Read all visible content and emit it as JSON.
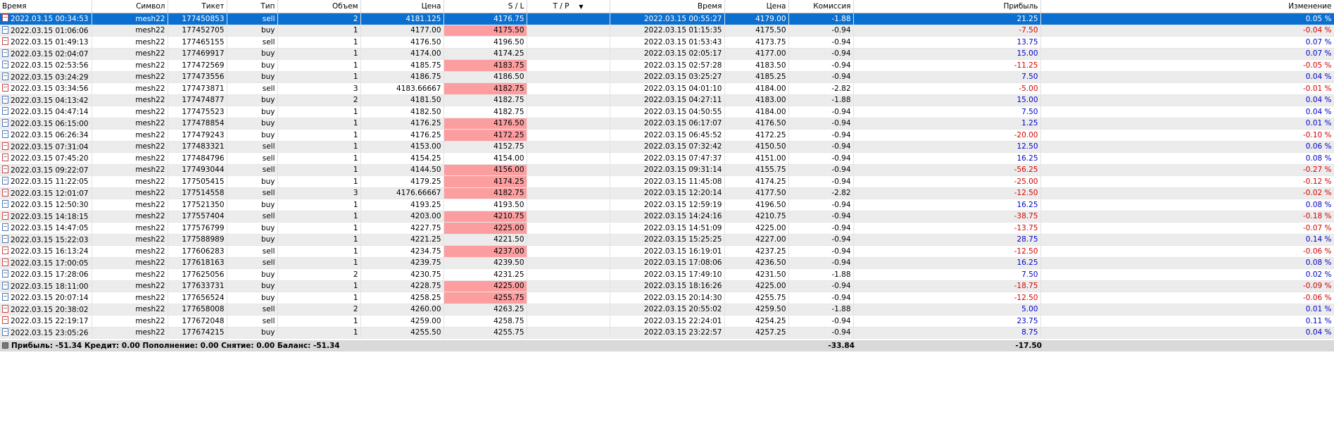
{
  "columns": [
    "Время",
    "Символ",
    "Тикет",
    "Тип",
    "Объем",
    "Цена",
    "S / L",
    "T / P",
    "Время",
    "Цена",
    "Комиссия",
    "Прибыль",
    "Изменение"
  ],
  "rows": [
    {
      "time": "2022.03.15 00:34:53",
      "symbol": "mesh22",
      "ticket": "177450853",
      "type": "sell",
      "volume": "2",
      "price": "4181.125",
      "sl": "4176.75",
      "tp": "",
      "close_time": "2022.03.15 00:55:27",
      "close_price": "4179.00",
      "commission": "-1.88",
      "profit": "21.25",
      "change": "0.05 %",
      "sl_hit": false,
      "selected": true
    },
    {
      "time": "2022.03.15 01:06:06",
      "symbol": "mesh22",
      "ticket": "177452705",
      "type": "buy",
      "volume": "1",
      "price": "4177.00",
      "sl": "4175.50",
      "tp": "",
      "close_time": "2022.03.15 01:15:35",
      "close_price": "4175.50",
      "commission": "-0.94",
      "profit": "-7.50",
      "change": "-0.04 %",
      "sl_hit": true
    },
    {
      "time": "2022.03.15 01:49:13",
      "symbol": "mesh22",
      "ticket": "177465155",
      "type": "sell",
      "volume": "1",
      "price": "4176.50",
      "sl": "4196.50",
      "tp": "",
      "close_time": "2022.03.15 01:53:43",
      "close_price": "4173.75",
      "commission": "-0.94",
      "profit": "13.75",
      "change": "0.07 %",
      "sl_hit": false
    },
    {
      "time": "2022.03.15 02:04:07",
      "symbol": "mesh22",
      "ticket": "177469917",
      "type": "buy",
      "volume": "1",
      "price": "4174.00",
      "sl": "4174.25",
      "tp": "",
      "close_time": "2022.03.15 02:05:17",
      "close_price": "4177.00",
      "commission": "-0.94",
      "profit": "15.00",
      "change": "0.07 %",
      "sl_hit": false
    },
    {
      "time": "2022.03.15 02:53:56",
      "symbol": "mesh22",
      "ticket": "177472569",
      "type": "buy",
      "volume": "1",
      "price": "4185.75",
      "sl": "4183.75",
      "tp": "",
      "close_time": "2022.03.15 02:57:28",
      "close_price": "4183.50",
      "commission": "-0.94",
      "profit": "-11.25",
      "change": "-0.05 %",
      "sl_hit": true
    },
    {
      "time": "2022.03.15 03:24:29",
      "symbol": "mesh22",
      "ticket": "177473556",
      "type": "buy",
      "volume": "1",
      "price": "4186.75",
      "sl": "4186.50",
      "tp": "",
      "close_time": "2022.03.15 03:25:27",
      "close_price": "4185.25",
      "commission": "-0.94",
      "profit": "7.50",
      "change": "0.04 %",
      "sl_hit": false
    },
    {
      "time": "2022.03.15 03:34:56",
      "symbol": "mesh22",
      "ticket": "177473871",
      "type": "sell",
      "volume": "3",
      "price": "4183.66667",
      "sl": "4182.75",
      "tp": "",
      "close_time": "2022.03.15 04:01:10",
      "close_price": "4184.00",
      "commission": "-2.82",
      "profit": "-5.00",
      "change": "-0.01 %",
      "sl_hit": true
    },
    {
      "time": "2022.03.15 04:13:42",
      "symbol": "mesh22",
      "ticket": "177474877",
      "type": "buy",
      "volume": "2",
      "price": "4181.50",
      "sl": "4182.75",
      "tp": "",
      "close_time": "2022.03.15 04:27:11",
      "close_price": "4183.00",
      "commission": "-1.88",
      "profit": "15.00",
      "change": "0.04 %",
      "sl_hit": false
    },
    {
      "time": "2022.03.15 04:47:14",
      "symbol": "mesh22",
      "ticket": "177475523",
      "type": "buy",
      "volume": "1",
      "price": "4182.50",
      "sl": "4182.75",
      "tp": "",
      "close_time": "2022.03.15 04:50:55",
      "close_price": "4184.00",
      "commission": "-0.94",
      "profit": "7.50",
      "change": "0.04 %",
      "sl_hit": false
    },
    {
      "time": "2022.03.15 06:15:00",
      "symbol": "mesh22",
      "ticket": "177478854",
      "type": "buy",
      "volume": "1",
      "price": "4176.25",
      "sl": "4176.50",
      "tp": "",
      "close_time": "2022.03.15 06:17:07",
      "close_price": "4176.50",
      "commission": "-0.94",
      "profit": "1.25",
      "change": "0.01 %",
      "sl_hit": true
    },
    {
      "time": "2022.03.15 06:26:34",
      "symbol": "mesh22",
      "ticket": "177479243",
      "type": "buy",
      "volume": "1",
      "price": "4176.25",
      "sl": "4172.25",
      "tp": "",
      "close_time": "2022.03.15 06:45:52",
      "close_price": "4172.25",
      "commission": "-0.94",
      "profit": "-20.00",
      "change": "-0.10 %",
      "sl_hit": true
    },
    {
      "time": "2022.03.15 07:31:04",
      "symbol": "mesh22",
      "ticket": "177483321",
      "type": "sell",
      "volume": "1",
      "price": "4153.00",
      "sl": "4152.75",
      "tp": "",
      "close_time": "2022.03.15 07:32:42",
      "close_price": "4150.50",
      "commission": "-0.94",
      "profit": "12.50",
      "change": "0.06 %",
      "sl_hit": false
    },
    {
      "time": "2022.03.15 07:45:20",
      "symbol": "mesh22",
      "ticket": "177484796",
      "type": "sell",
      "volume": "1",
      "price": "4154.25",
      "sl": "4154.00",
      "tp": "",
      "close_time": "2022.03.15 07:47:37",
      "close_price": "4151.00",
      "commission": "-0.94",
      "profit": "16.25",
      "change": "0.08 %",
      "sl_hit": false
    },
    {
      "time": "2022.03.15 09:22:07",
      "symbol": "mesh22",
      "ticket": "177493044",
      "type": "sell",
      "volume": "1",
      "price": "4144.50",
      "sl": "4156.00",
      "tp": "",
      "close_time": "2022.03.15 09:31:14",
      "close_price": "4155.75",
      "commission": "-0.94",
      "profit": "-56.25",
      "change": "-0.27 %",
      "sl_hit": true
    },
    {
      "time": "2022.03.15 11:22:05",
      "symbol": "mesh22",
      "ticket": "177505415",
      "type": "buy",
      "volume": "1",
      "price": "4179.25",
      "sl": "4174.25",
      "tp": "",
      "close_time": "2022.03.15 11:45:08",
      "close_price": "4174.25",
      "commission": "-0.94",
      "profit": "-25.00",
      "change": "-0.12 %",
      "sl_hit": true
    },
    {
      "time": "2022.03.15 12:01:07",
      "symbol": "mesh22",
      "ticket": "177514558",
      "type": "sell",
      "volume": "3",
      "price": "4176.66667",
      "sl": "4182.75",
      "tp": "",
      "close_time": "2022.03.15 12:20:14",
      "close_price": "4177.50",
      "commission": "-2.82",
      "profit": "-12.50",
      "change": "-0.02 %",
      "sl_hit": true
    },
    {
      "time": "2022.03.15 12:50:30",
      "symbol": "mesh22",
      "ticket": "177521350",
      "type": "buy",
      "volume": "1",
      "price": "4193.25",
      "sl": "4193.50",
      "tp": "",
      "close_time": "2022.03.15 12:59:19",
      "close_price": "4196.50",
      "commission": "-0.94",
      "profit": "16.25",
      "change": "0.08 %",
      "sl_hit": false
    },
    {
      "time": "2022.03.15 14:18:15",
      "symbol": "mesh22",
      "ticket": "177557404",
      "type": "sell",
      "volume": "1",
      "price": "4203.00",
      "sl": "4210.75",
      "tp": "",
      "close_time": "2022.03.15 14:24:16",
      "close_price": "4210.75",
      "commission": "-0.94",
      "profit": "-38.75",
      "change": "-0.18 %",
      "sl_hit": true
    },
    {
      "time": "2022.03.15 14:47:05",
      "symbol": "mesh22",
      "ticket": "177576799",
      "type": "buy",
      "volume": "1",
      "price": "4227.75",
      "sl": "4225.00",
      "tp": "",
      "close_time": "2022.03.15 14:51:09",
      "close_price": "4225.00",
      "commission": "-0.94",
      "profit": "-13.75",
      "change": "-0.07 %",
      "sl_hit": true
    },
    {
      "time": "2022.03.15 15:22:03",
      "symbol": "mesh22",
      "ticket": "177588989",
      "type": "buy",
      "volume": "1",
      "price": "4221.25",
      "sl": "4221.50",
      "tp": "",
      "close_time": "2022.03.15 15:25:25",
      "close_price": "4227.00",
      "commission": "-0.94",
      "profit": "28.75",
      "change": "0.14 %",
      "sl_hit": false
    },
    {
      "time": "2022.03.15 16:13:24",
      "symbol": "mesh22",
      "ticket": "177606283",
      "type": "sell",
      "volume": "1",
      "price": "4234.75",
      "sl": "4237.00",
      "tp": "",
      "close_time": "2022.03.15 16:19:01",
      "close_price": "4237.25",
      "commission": "-0.94",
      "profit": "-12.50",
      "change": "-0.06 %",
      "sl_hit": true
    },
    {
      "time": "2022.03.15 17:00:05",
      "symbol": "mesh22",
      "ticket": "177618163",
      "type": "sell",
      "volume": "1",
      "price": "4239.75",
      "sl": "4239.50",
      "tp": "",
      "close_time": "2022.03.15 17:08:06",
      "close_price": "4236.50",
      "commission": "-0.94",
      "profit": "16.25",
      "change": "0.08 %",
      "sl_hit": false
    },
    {
      "time": "2022.03.15 17:28:06",
      "symbol": "mesh22",
      "ticket": "177625056",
      "type": "buy",
      "volume": "2",
      "price": "4230.75",
      "sl": "4231.25",
      "tp": "",
      "close_time": "2022.03.15 17:49:10",
      "close_price": "4231.50",
      "commission": "-1.88",
      "profit": "7.50",
      "change": "0.02 %",
      "sl_hit": false
    },
    {
      "time": "2022.03.15 18:11:00",
      "symbol": "mesh22",
      "ticket": "177633731",
      "type": "buy",
      "volume": "1",
      "price": "4228.75",
      "sl": "4225.00",
      "tp": "",
      "close_time": "2022.03.15 18:16:26",
      "close_price": "4225.00",
      "commission": "-0.94",
      "profit": "-18.75",
      "change": "-0.09 %",
      "sl_hit": true
    },
    {
      "time": "2022.03.15 20:07:14",
      "symbol": "mesh22",
      "ticket": "177656524",
      "type": "buy",
      "volume": "1",
      "price": "4258.25",
      "sl": "4255.75",
      "tp": "",
      "close_time": "2022.03.15 20:14:30",
      "close_price": "4255.75",
      "commission": "-0.94",
      "profit": "-12.50",
      "change": "-0.06 %",
      "sl_hit": true
    },
    {
      "time": "2022.03.15 20:38:02",
      "symbol": "mesh22",
      "ticket": "177658008",
      "type": "sell",
      "volume": "2",
      "price": "4260.00",
      "sl": "4263.25",
      "tp": "",
      "close_time": "2022.03.15 20:55:02",
      "close_price": "4259.50",
      "commission": "-1.88",
      "profit": "5.00",
      "change": "0.01 %",
      "sl_hit": false
    },
    {
      "time": "2022.03.15 22:19:17",
      "symbol": "mesh22",
      "ticket": "177672048",
      "type": "sell",
      "volume": "1",
      "price": "4259.00",
      "sl": "4258.75",
      "tp": "",
      "close_time": "2022.03.15 22:24:01",
      "close_price": "4254.25",
      "commission": "-0.94",
      "profit": "23.75",
      "change": "0.11 %",
      "sl_hit": false
    },
    {
      "time": "2022.03.15 23:05:26",
      "symbol": "mesh22",
      "ticket": "177674215",
      "type": "buy",
      "volume": "1",
      "price": "4255.50",
      "sl": "4255.75",
      "tp": "",
      "close_time": "2022.03.15 23:22:57",
      "close_price": "4257.25",
      "commission": "-0.94",
      "profit": "8.75",
      "change": "0.04 %",
      "sl_hit": false
    }
  ],
  "summary": {
    "text": "Прибыль: -51.34  Кредит: 0.00  Пополнение: 0.00  Снятие: 0.00  Баланс: -51.34",
    "commission_total": "-33.84",
    "profit_total": "-17.50"
  },
  "colors": {
    "selected_row": "#0a6fd1",
    "sl_highlight": "#fc9ea0",
    "positive": "#0000c8",
    "negative": "#d40000",
    "summary_bar": "#d9d9d9"
  },
  "icons": {
    "row_icon": "deal-document-icon",
    "sort_icon": "sort-down-icon",
    "summary_icon": "balance-icon"
  }
}
